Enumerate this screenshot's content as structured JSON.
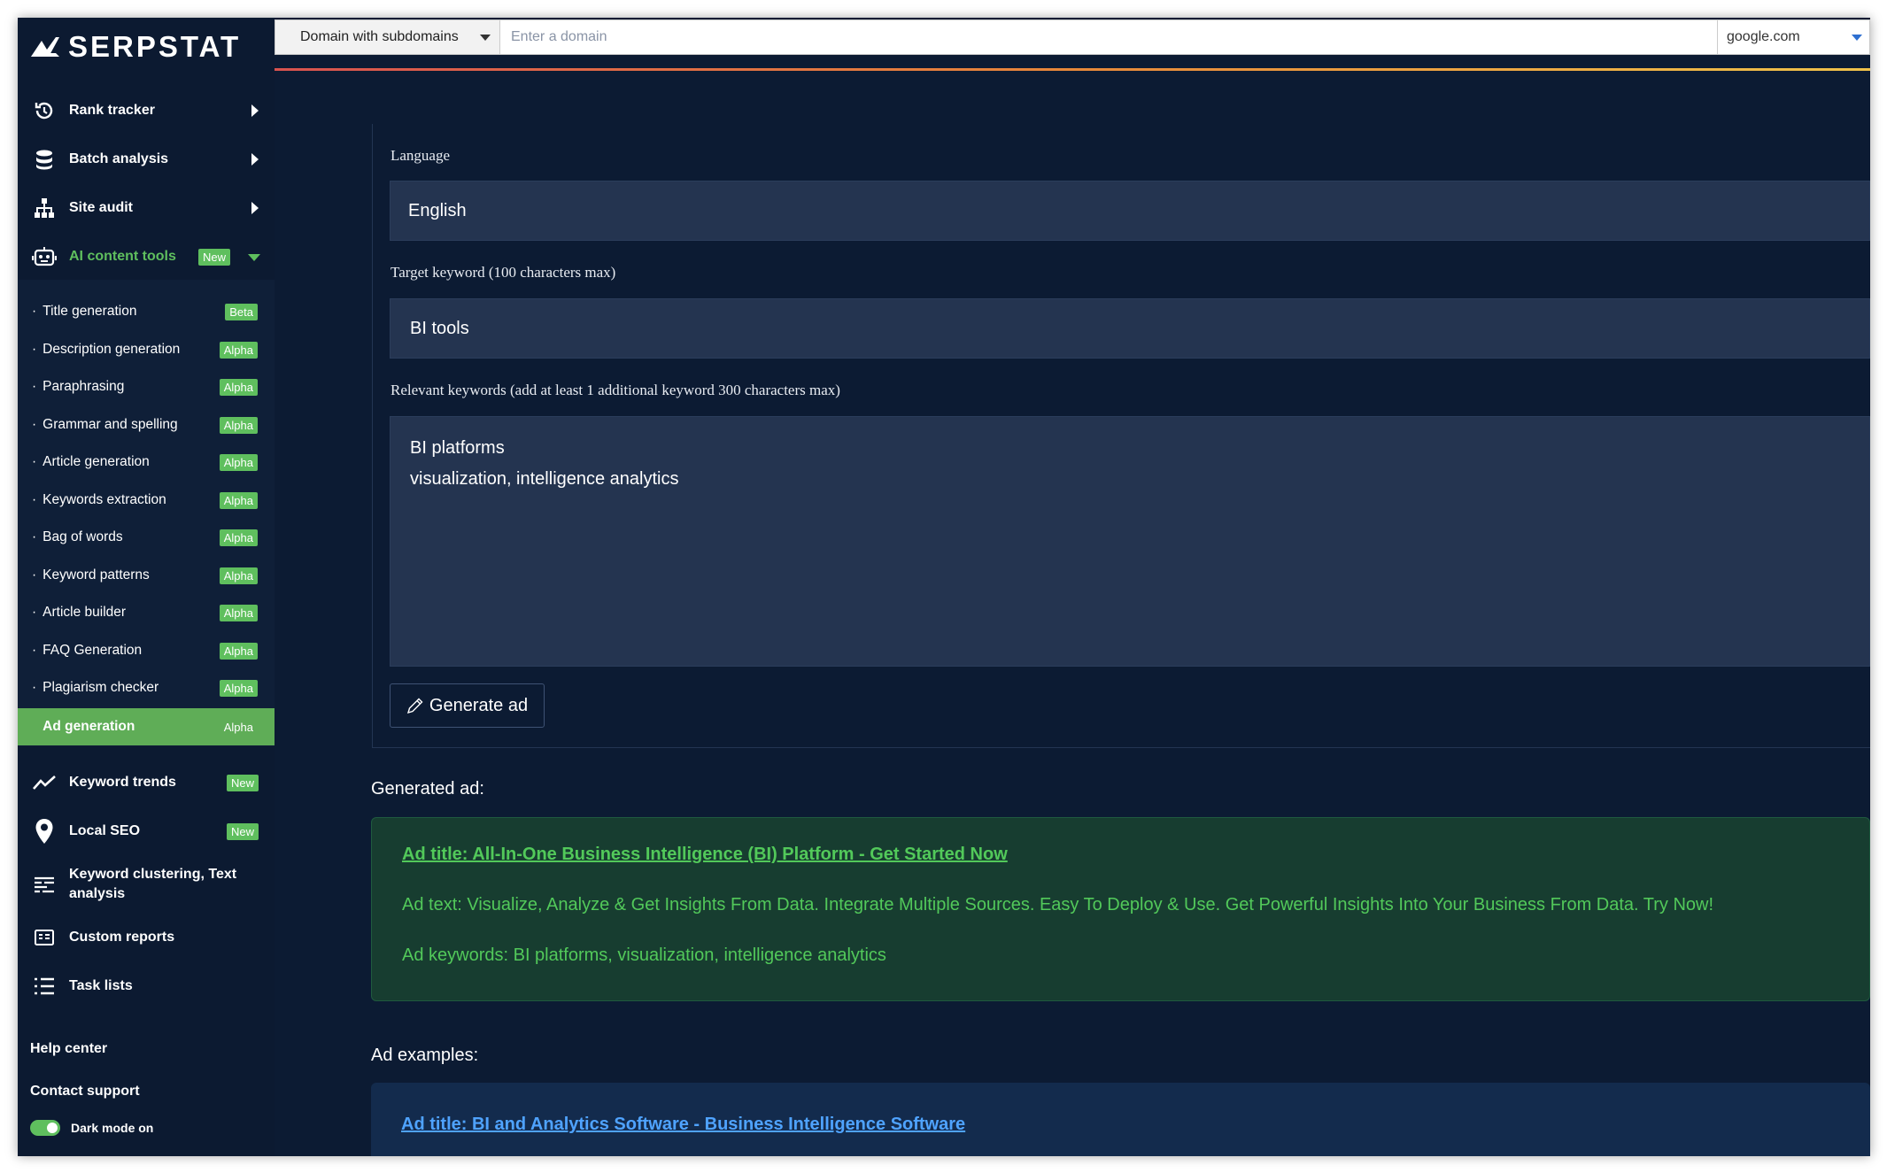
{
  "brand": {
    "name": "SERPSTAT"
  },
  "topbar": {
    "scope_value": "Domain with subdomains",
    "domain_placeholder": "Enter a domain",
    "search_engine": "google.com"
  },
  "sidebar": {
    "menu": [
      {
        "label": "Rank tracker",
        "icon": "history-icon"
      },
      {
        "label": "Batch analysis",
        "icon": "database-icon"
      },
      {
        "label": "Site audit",
        "icon": "sitemap-icon"
      },
      {
        "label": "AI content tools",
        "icon": "robot-icon",
        "badge": "New"
      }
    ],
    "ai_tools": [
      {
        "label": "Title generation",
        "badge": "Beta"
      },
      {
        "label": "Description generation",
        "badge": "Alpha"
      },
      {
        "label": "Paraphrasing",
        "badge": "Alpha"
      },
      {
        "label": "Grammar and spelling",
        "badge": "Alpha"
      },
      {
        "label": "Article generation",
        "badge": "Alpha"
      },
      {
        "label": "Keywords extraction",
        "badge": "Alpha"
      },
      {
        "label": "Bag of words",
        "badge": "Alpha"
      },
      {
        "label": "Keyword patterns",
        "badge": "Alpha"
      },
      {
        "label": "Article builder",
        "badge": "Alpha"
      },
      {
        "label": "FAQ Generation",
        "badge": "Alpha"
      },
      {
        "label": "Plagiarism checker",
        "badge": "Alpha"
      },
      {
        "label": "Ad generation",
        "badge": "Alpha"
      }
    ],
    "menu2": [
      {
        "label": "Keyword trends",
        "icon": "trend-line-icon",
        "badge": "New"
      },
      {
        "label": "Local SEO",
        "icon": "map-pin-icon",
        "badge": "New"
      },
      {
        "label": "Keyword clustering, Text analysis",
        "label_line1": "Keyword clustering, Text",
        "label_line2": "analysis",
        "icon": "clustering-icon"
      },
      {
        "label": "Custom reports",
        "icon": "report-icon"
      },
      {
        "label": "Task lists",
        "icon": "task-list-icon"
      }
    ],
    "help_center": "Help center",
    "contact_support": "Contact support",
    "dark_mode": "Dark mode on"
  },
  "form": {
    "language_label": "Language",
    "language_value": "English",
    "target_keyword_label": "Target keyword (100 characters max)",
    "target_keyword_value": "BI tools",
    "relevant_keywords_label": "Relevant keywords (add at least 1 additional keyword 300 characters max)",
    "relevant_keywords_line1": "BI platforms",
    "relevant_keywords_line2": "visualization, intelligence analytics",
    "generate_button": "Generate ad"
  },
  "generated": {
    "heading": "Generated ad:",
    "ad_title": "Ad title: All-In-One Business Intelligence (BI) Platform - Get Started Now",
    "ad_text": "Ad text: Visualize, Analyze & Get Insights From Data. Integrate Multiple Sources. Easy To Deploy & Use. Get Powerful Insights Into Your Business From Data. Try Now!",
    "ad_keywords": "Ad keywords: BI platforms, visualization, intelligence analytics"
  },
  "examples": {
    "heading": "Ad examples:",
    "first_title": "Ad title: BI and Analytics Software - Business Intelligence Software"
  },
  "colors": {
    "background": "#0c1b33",
    "accent_green": "#5fbf5e",
    "ad_text_green": "#52c95a",
    "link_blue": "#4fa3ff"
  }
}
